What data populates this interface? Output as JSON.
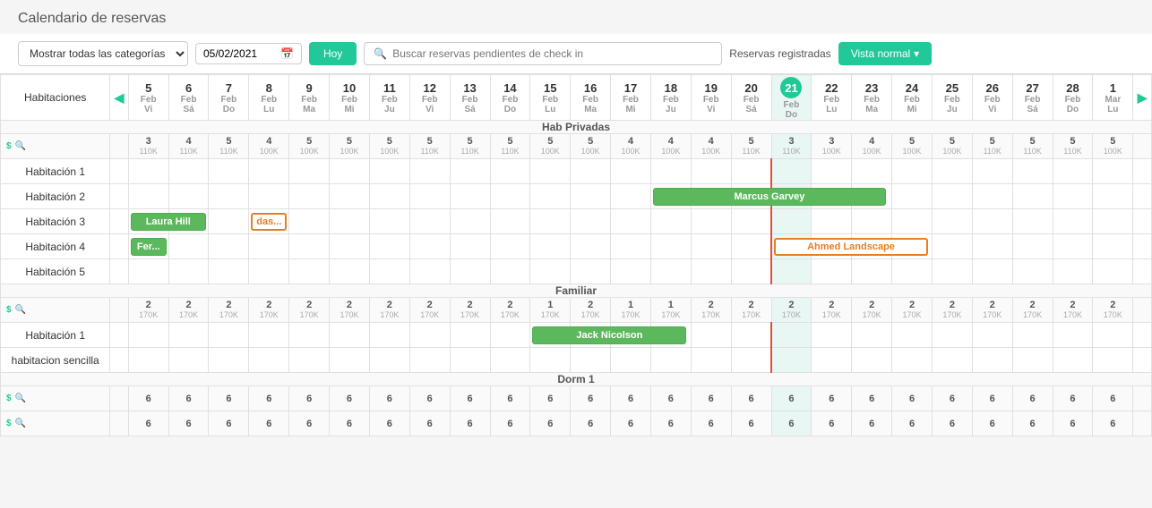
{
  "page": {
    "title": "Calendario de reservas"
  },
  "toolbar": {
    "category_placeholder": "Mostrar todas las categorías",
    "date_value": "05/02/2021",
    "btn_hoy": "Hoy",
    "search_placeholder": "Buscar reservas pendientes de check in",
    "reservas_label": "Reservas registradas",
    "btn_vista": "Vista normal"
  },
  "calendar": {
    "nav_left": "◀",
    "nav_right": "▶",
    "col_header": "Habitaciones",
    "days": [
      {
        "num": "5",
        "month": "Feb",
        "week": "Vi"
      },
      {
        "num": "6",
        "month": "Feb",
        "week": "Sá"
      },
      {
        "num": "7",
        "month": "Feb",
        "week": "Do"
      },
      {
        "num": "8",
        "month": "Feb",
        "week": "Lu"
      },
      {
        "num": "9",
        "month": "Feb",
        "week": "Ma"
      },
      {
        "num": "10",
        "month": "Feb",
        "week": "Mi"
      },
      {
        "num": "11",
        "month": "Feb",
        "week": "Ju"
      },
      {
        "num": "12",
        "month": "Feb",
        "week": "Vi"
      },
      {
        "num": "13",
        "month": "Feb",
        "week": "Sá"
      },
      {
        "num": "14",
        "month": "Feb",
        "week": "Do"
      },
      {
        "num": "15",
        "month": "Feb",
        "week": "Lu"
      },
      {
        "num": "16",
        "month": "Feb",
        "week": "Ma"
      },
      {
        "num": "17",
        "month": "Feb",
        "week": "Mi"
      },
      {
        "num": "18",
        "month": "Feb",
        "week": "Ju"
      },
      {
        "num": "19",
        "month": "Feb",
        "week": "Vi"
      },
      {
        "num": "20",
        "month": "Feb",
        "week": "Sá"
      },
      {
        "num": "21",
        "month": "Feb",
        "week": "Do",
        "today": true
      },
      {
        "num": "22",
        "month": "Feb",
        "week": "Lu"
      },
      {
        "num": "23",
        "month": "Feb",
        "week": "Ma"
      },
      {
        "num": "24",
        "month": "Feb",
        "week": "Mi"
      },
      {
        "num": "25",
        "month": "Feb",
        "week": "Ju"
      },
      {
        "num": "26",
        "month": "Feb",
        "week": "Vi"
      },
      {
        "num": "27",
        "month": "Feb",
        "week": "Sá"
      },
      {
        "num": "28",
        "month": "Feb",
        "week": "Do"
      },
      {
        "num": "1",
        "month": "Mar",
        "week": "Lu"
      }
    ],
    "sections": [
      {
        "name": "Hab Privadas",
        "prices": [
          "3\n110K",
          "4\n110K",
          "5\n110K",
          "4\n100K",
          "5\n100K",
          "5\n100K",
          "5\n100K",
          "5\n110K",
          "5\n110K",
          "5\n110K",
          "5\n100K",
          "5\n100K",
          "4\n100K",
          "4\n100K",
          "4\n100K",
          "5\n110K",
          "3\n110K",
          "3\n100K",
          "4\n100K",
          "5\n100K",
          "5\n100K",
          "5\n110K",
          "5\n110K",
          "5\n110K",
          "5\n100K"
        ],
        "rooms": [
          {
            "name": "Habitación 1",
            "bookings": []
          },
          {
            "name": "Habitación 2",
            "bookings": [
              {
                "label": "Marcus Garvey",
                "start": 13,
                "span": 6,
                "type": "green"
              }
            ]
          },
          {
            "name": "Habitación 3",
            "bookings": [
              {
                "label": "Laura Hill",
                "start": 0,
                "span": 2,
                "type": "green"
              },
              {
                "label": "das...",
                "start": 3,
                "span": 1,
                "type": "outline"
              }
            ]
          },
          {
            "name": "Habitación 4",
            "bookings": [
              {
                "label": "Fer...",
                "start": 0,
                "span": 1,
                "type": "green"
              },
              {
                "label": "Ahmed Landscape",
                "start": 16,
                "span": 4,
                "type": "outline"
              }
            ]
          },
          {
            "name": "Habitación 5",
            "bookings": []
          }
        ]
      },
      {
        "name": "Familiar",
        "prices": [
          "2\n170K",
          "2\n170K",
          "2\n170K",
          "2\n170K",
          "2\n170K",
          "2\n170K",
          "2\n170K",
          "2\n170K",
          "2\n170K",
          "2\n170K",
          "1\n170K",
          "2\n170K",
          "1\n170K",
          "1\n170K",
          "2\n170K",
          "2\n170K",
          "2\n170K",
          "2\n170K",
          "2\n170K",
          "2\n170K",
          "2\n170K",
          "2\n170K",
          "2\n170K",
          "2\n170K",
          "2\n170K"
        ],
        "rooms": [
          {
            "name": "Habitación 1",
            "bookings": [
              {
                "label": "Jack Nicolson",
                "start": 10,
                "span": 4,
                "type": "green"
              }
            ]
          },
          {
            "name": "habitacion sencilla",
            "bookings": []
          }
        ]
      },
      {
        "name": "Dorm 1",
        "prices": [
          "6",
          "6",
          "6",
          "6",
          "6",
          "6",
          "6",
          "6",
          "6",
          "6",
          "6",
          "6",
          "6",
          "6",
          "6",
          "6",
          "6",
          "6",
          "6",
          "6",
          "6",
          "6",
          "6",
          "6",
          "6"
        ],
        "rooms": []
      }
    ]
  }
}
